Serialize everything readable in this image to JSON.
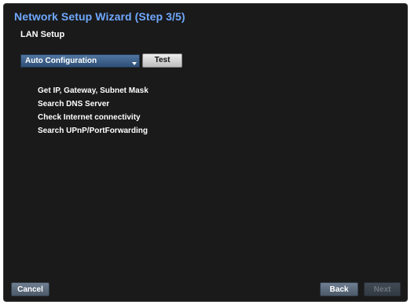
{
  "wizard": {
    "title": "Network Setup Wizard (Step 3/5)",
    "subtitle": "LAN Setup"
  },
  "config": {
    "mode_selected": "Auto Configuration",
    "test_label": "Test"
  },
  "steps": [
    "Get IP, Gateway, Subnet Mask",
    "Search DNS Server",
    "Check Internet connectivity",
    "Search UPnP/PortForwarding"
  ],
  "footer": {
    "cancel_label": "Cancel",
    "back_label": "Back",
    "next_label": "Next"
  },
  "colors": {
    "title": "#6fa8ff",
    "background": "#1a1a1a",
    "select_accent": "#3d6189",
    "button_disabled_text": "#6d757d"
  },
  "icons": {
    "select_arrow": "chevron-down-icon"
  }
}
